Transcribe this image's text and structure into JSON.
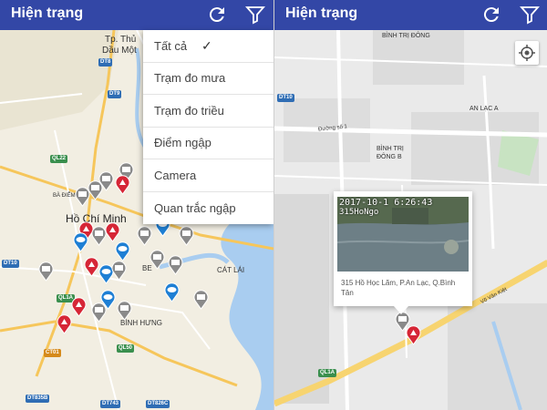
{
  "app": {
    "title": "Hiện trạng"
  },
  "toolbar": {
    "refresh_icon": "refresh-icon",
    "filter_icon": "filter-icon"
  },
  "filter_menu": {
    "items": [
      "Tất cả",
      "Trạm đo mưa",
      "Trạm đo triều",
      "Điểm ngập",
      "Camera",
      "Quan trắc ngập"
    ],
    "selected": "Tất cả",
    "check_mark": "✓"
  },
  "left_map": {
    "labels": {
      "city1": "Tp. Thủ",
      "city2": "Dầu Một",
      "hcm": "Hồ Chí Minh",
      "binh_hung": "BÌNH HƯNG",
      "cat_lai": "CÁT LÁI",
      "ba_diem": "BÀ ĐIỂM",
      "be": "BE"
    },
    "shields": [
      "DT8",
      "DT9",
      "QL22",
      "DT10",
      "QL1A",
      "CT01",
      "DT835B",
      "QL50",
      "DT826C",
      "DT743"
    ]
  },
  "right_map": {
    "labels": {
      "binh_tri_dong": "BÌNH TRỊ ĐÔNG",
      "an_lac_a": "AN LẠC A",
      "binh_tri_dong_b1": "BÌNH TRỊ",
      "binh_tri_dong_b2": "ĐÔNG B",
      "street": "Đường số 1",
      "vo_van_kiet": "Võ Văn Kiệt"
    },
    "shields": [
      "DT10",
      "QL1A"
    ]
  },
  "info_window": {
    "timestamp": "2017-10-1  6:26:43",
    "station": "315HoNgo",
    "address": "315 Hồ Học Lãm, P.An Lạc, Q.Bình Tân"
  },
  "colors": {
    "appbar": "#3347a6",
    "marker_red": "#d62636",
    "marker_blue": "#1e7fd4",
    "marker_gray": "#8a8a8a"
  }
}
